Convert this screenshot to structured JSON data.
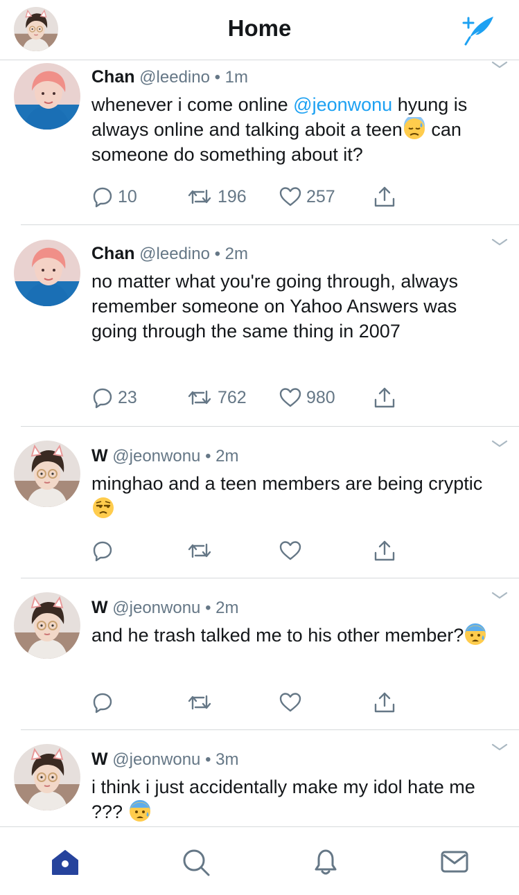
{
  "header": {
    "title": "Home",
    "compose_icon": "compose-feather-icon",
    "avatar_icon": "profile-avatar"
  },
  "colors": {
    "accent": "#1da1f2",
    "text": "#14171a",
    "muted": "#657786",
    "divider": "#d6d9db",
    "home_tab": "#26439c"
  },
  "tweets": [
    {
      "name": "Chan",
      "handle": "@leedino",
      "time": "• 1m",
      "text_before": "whenever i come online ",
      "mention": "@jeonwonu",
      "text_after": " hyung is always online and talking aboit a teen",
      "emoji": "downcast-sweat-emoji",
      "text_end": " can someone do something about it?",
      "replies": "10",
      "retweets": "196",
      "likes": "257"
    },
    {
      "name": "Chan",
      "handle": "@leedino",
      "time": "• 2m",
      "text": "no matter what you're going through, always remember someone on Yahoo Answers was going through the same thing in 2007",
      "replies": "23",
      "retweets": "762",
      "likes": "980"
    },
    {
      "name": "W",
      "handle": "@jeonwonu",
      "time": "• 2m",
      "text": "minghao and a teen members are being cryptic ",
      "emoji": "unamused-emoji"
    },
    {
      "name": "W",
      "handle": "@jeonwonu",
      "time": "• 2m",
      "text": "and he trash talked me to his other member?",
      "emoji": "anxious-sweat-emoji"
    },
    {
      "name": "W",
      "handle": "@jeonwonu",
      "time": "• 3m",
      "text": "i think i just accidentally make my idol hate me ??? ",
      "emoji": "anxious-sweat-emoji"
    }
  ],
  "tabs": [
    "home-icon",
    "search-icon",
    "notifications-icon",
    "messages-icon"
  ]
}
